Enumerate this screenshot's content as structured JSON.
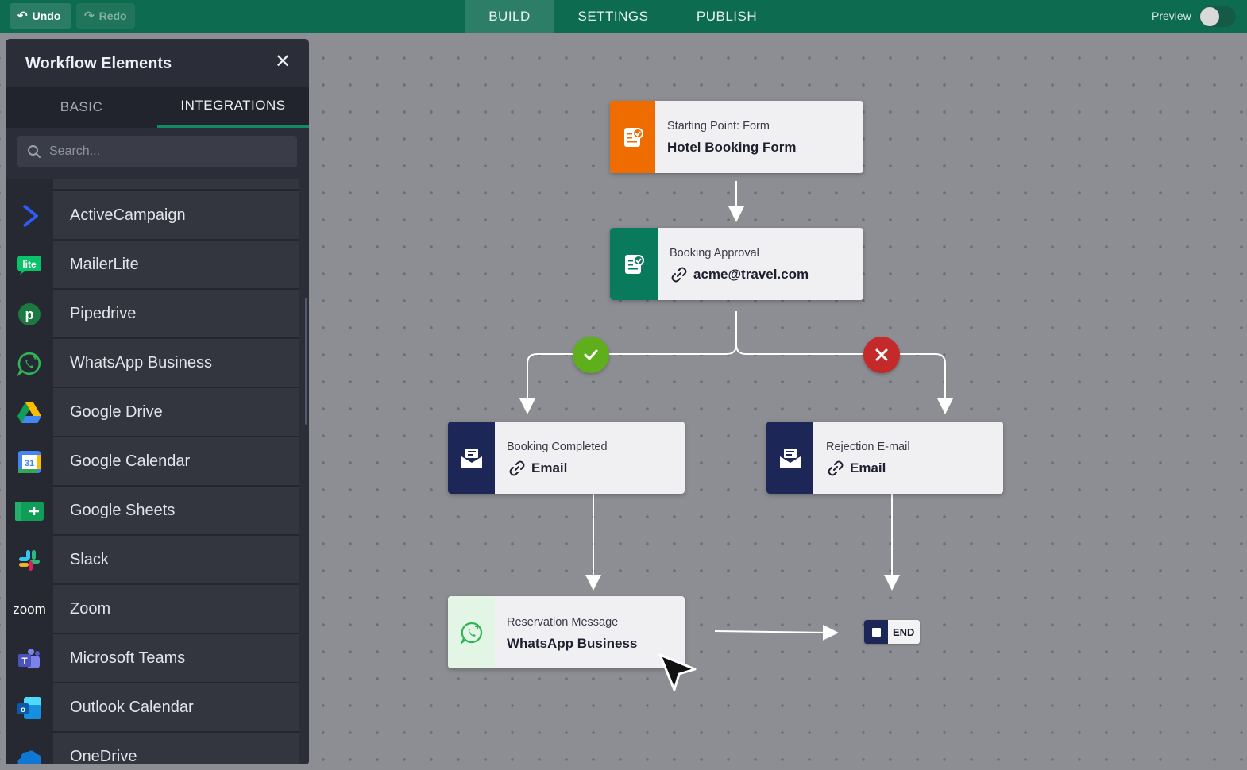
{
  "toolbar": {
    "undo_label": "Undo",
    "redo_label": "Redo",
    "tabs": [
      {
        "label": "BUILD",
        "active": true
      },
      {
        "label": "SETTINGS",
        "active": false
      },
      {
        "label": "PUBLISH",
        "active": false
      }
    ],
    "preview_label": "Preview",
    "preview_on": false
  },
  "panel": {
    "title": "Workflow Elements",
    "tabs": [
      {
        "label": "BASIC",
        "active": false
      },
      {
        "label": "INTEGRATIONS",
        "active": true
      }
    ],
    "search_placeholder": "Search...",
    "items": [
      {
        "label": "ActiveCampaign",
        "icon": "activecampaign-icon"
      },
      {
        "label": "MailerLite",
        "icon": "mailerlite-icon"
      },
      {
        "label": "Pipedrive",
        "icon": "pipedrive-icon"
      },
      {
        "label": "WhatsApp Business",
        "icon": "whatsapp-icon"
      },
      {
        "label": "Google Drive",
        "icon": "google-drive-icon"
      },
      {
        "label": "Google Calendar",
        "icon": "google-calendar-icon"
      },
      {
        "label": "Google Sheets",
        "icon": "google-sheets-icon"
      },
      {
        "label": "Slack",
        "icon": "slack-icon"
      },
      {
        "label": "Zoom",
        "icon": "zoom-icon"
      },
      {
        "label": "Microsoft Teams",
        "icon": "microsoft-teams-icon"
      },
      {
        "label": "Outlook Calendar",
        "icon": "outlook-calendar-icon"
      },
      {
        "label": "OneDrive",
        "icon": "onedrive-icon"
      }
    ]
  },
  "flow": {
    "start": {
      "subtitle": "Starting Point: Form",
      "title": "Hotel Booking Form",
      "color": "#ef6c00"
    },
    "approval": {
      "subtitle": "Booking Approval",
      "title": "acme@travel.com",
      "color": "#0a7a5c"
    },
    "completed": {
      "subtitle": "Booking Completed",
      "title": "Email",
      "color": "#1d2757"
    },
    "rejection": {
      "subtitle": "Rejection E-mail",
      "title": "Email",
      "color": "#1d2757"
    },
    "reservation": {
      "subtitle": "Reservation Message",
      "title": "WhatsApp Business",
      "color": "#e3f6e5"
    },
    "end_label": "END",
    "approve_color": "#5fae1b",
    "reject_color": "#c42a2a"
  }
}
